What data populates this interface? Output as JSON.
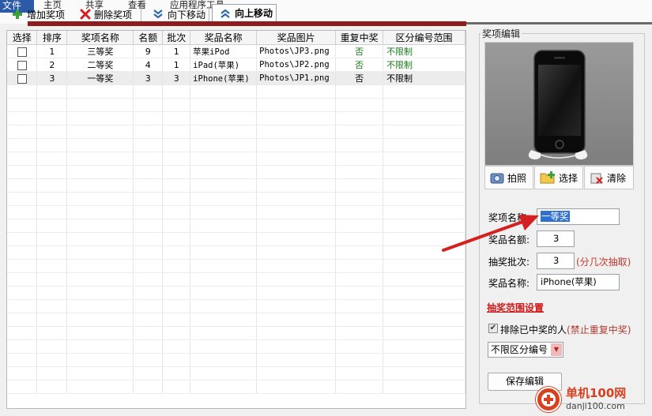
{
  "menu": {
    "tabs": [
      "文件",
      "主页",
      "共享",
      "查看",
      "应用程序工具"
    ]
  },
  "toolbar": {
    "add_label": "增加奖项",
    "delete_label": "删除奖项",
    "move_down_label": "向下移动",
    "move_up_label": "向上移动"
  },
  "grid": {
    "columns": [
      "选择",
      "排序",
      "奖项名称",
      "名额",
      "批次",
      "奖品名称",
      "奖品图片",
      "重复中奖",
      "区分编号范围"
    ],
    "rows": [
      {
        "checked": false,
        "order": "1",
        "award": "三等奖",
        "quota": "9",
        "batch": "1",
        "prize": "苹果iPod",
        "image": "Photos\\JP3.png",
        "repeat": "否",
        "range": "不限制"
      },
      {
        "checked": false,
        "order": "2",
        "award": "二等奖",
        "quota": "4",
        "batch": "1",
        "prize": "iPad(苹果)",
        "image": "Photos\\JP2.png",
        "repeat": "否",
        "range": "不限制"
      },
      {
        "checked": false,
        "order": "3",
        "award": "一等奖",
        "quota": "3",
        "batch": "3",
        "prize": "iPhone(苹果)",
        "image": "Photos\\JP1.png",
        "repeat": "否",
        "range": "不限制"
      }
    ]
  },
  "editor": {
    "title": "奖项编辑",
    "photo_label": "拍照",
    "select_label": "选择",
    "clear_label": "清除",
    "award_name_label": "奖项名称:",
    "award_name_value": "一等奖",
    "quota_label": "奖品名额:",
    "quota_value": "3",
    "batch_label": "抽奖批次:",
    "batch_value": "3",
    "batch_hint": "(分几次抽取)",
    "prize_name_label": "奖品名称:",
    "prize_name_value": "iPhone(苹果)",
    "range_title": "抽奖范围设置",
    "exclude_label": "排除已中奖的人",
    "exclude_hint": "(禁止重复中奖)",
    "exclude_checked": true,
    "zone_value": "不限区分编号",
    "save_label": "保存编辑"
  },
  "watermark": {
    "name": "单机100网",
    "url": "danji100.com"
  },
  "colors": {
    "accent_blue": "#2b5aa8",
    "highlight_red": "#d01818",
    "green_text": "#1b7c1b",
    "annotation_arrow": "#d42020"
  }
}
